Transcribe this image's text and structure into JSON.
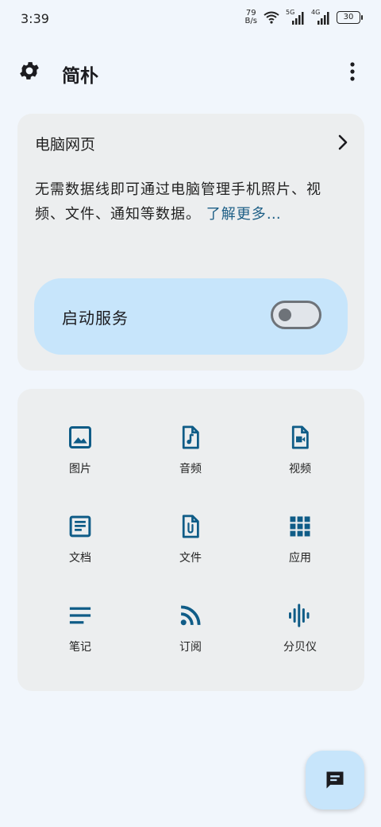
{
  "status_bar": {
    "time": "3:39",
    "net_speed_value": "79",
    "net_speed_unit": "B/s",
    "sig1_tag": "5G",
    "sig2_tag": "4G",
    "battery": "30"
  },
  "app_bar": {
    "title": "简朴"
  },
  "web_card": {
    "title": "电脑网页",
    "description": "无需数据线即可通过电脑管理手机照片、视频、文件、通知等数据。",
    "learn_more": "了解更多…",
    "service_label": "启动服务",
    "service_enabled": false
  },
  "grid": {
    "items": [
      {
        "label": "图片",
        "icon": "image-icon"
      },
      {
        "label": "音频",
        "icon": "audio-file-icon"
      },
      {
        "label": "视频",
        "icon": "video-file-icon"
      },
      {
        "label": "文档",
        "icon": "document-icon"
      },
      {
        "label": "文件",
        "icon": "attachment-file-icon"
      },
      {
        "label": "应用",
        "icon": "apps-grid-icon"
      },
      {
        "label": "笔记",
        "icon": "notes-icon"
      },
      {
        "label": "订阅",
        "icon": "rss-icon"
      },
      {
        "label": "分贝仪",
        "icon": "sound-wave-icon"
      }
    ]
  },
  "colors": {
    "accent": "#1d5f86",
    "pill": "#c7e5fb",
    "card": "#eceeef",
    "background": "#f1f6fc"
  }
}
